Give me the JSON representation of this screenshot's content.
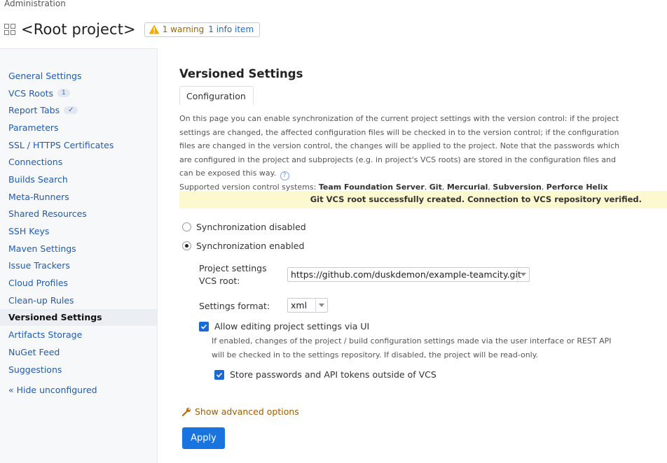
{
  "breadcrumb": "Administration",
  "header": {
    "title": "<Root project>",
    "warning_text": "1 warning",
    "info_text": "1 info item"
  },
  "sidebar": {
    "items": [
      {
        "label": "General Settings"
      },
      {
        "label": "VCS Roots",
        "count": "1"
      },
      {
        "label": "Report Tabs",
        "check": "✓"
      },
      {
        "label": "Parameters"
      },
      {
        "label": "SSL / HTTPS Certificates"
      },
      {
        "label": "Connections"
      },
      {
        "label": "Builds Search"
      },
      {
        "label": "Meta-Runners"
      },
      {
        "label": "Shared Resources"
      },
      {
        "label": "SSH Keys"
      },
      {
        "label": "Maven Settings"
      },
      {
        "label": "Issue Trackers"
      },
      {
        "label": "Cloud Profiles"
      },
      {
        "label": "Clean-up Rules"
      },
      {
        "label": "Versioned Settings",
        "active": true
      },
      {
        "label": "Artifacts Storage"
      },
      {
        "label": "NuGet Feed"
      },
      {
        "label": "Suggestions"
      }
    ],
    "hide_link": "« Hide unconfigured"
  },
  "main": {
    "title": "Versioned Settings",
    "tab": "Configuration",
    "description": "On this page you can enable synchronization of the current project settings with the version control: if the project settings are changed, the affected configuration files will be checked in to the version control; if the configuration files are changed in the version control, the changes will be applied to the project. Note that the passwords which are configured in the project and subprojects (e.g. in project's VCS roots) are stored in the configuration files and can be exposed this way.",
    "supported_prefix": "Supported version control systems: ",
    "supported_vcs": [
      "Team Foundation Server",
      "Git",
      "Mercurial",
      "Subversion",
      "Perforce Helix Core"
    ],
    "notice": "Git VCS root successfully created. Connection to VCS repository verified.",
    "radio_disabled": "Synchronization disabled",
    "radio_enabled": "Synchronization enabled",
    "vcs_root_label": "Project settings VCS root:",
    "vcs_root_value": "https://github.com/duskdemon/example-teamcity.git",
    "format_label": "Settings format:",
    "format_value": "xml",
    "allow_edit_label": "Allow editing project settings via UI",
    "allow_edit_hint": "If enabled, changes of the project / build configuration settings made via the user interface or REST API will be checked in to the settings repository. If disabled, the project will be read-only.",
    "store_passwords_label": "Store passwords and API tokens outside of VCS",
    "advanced_link": "Show advanced options",
    "apply_button": "Apply"
  },
  "colors": {
    "link": "#1f5bb5",
    "primary_button": "#1a74e0",
    "notice_bg": "#fcf8d0",
    "warning": "#a06400"
  }
}
